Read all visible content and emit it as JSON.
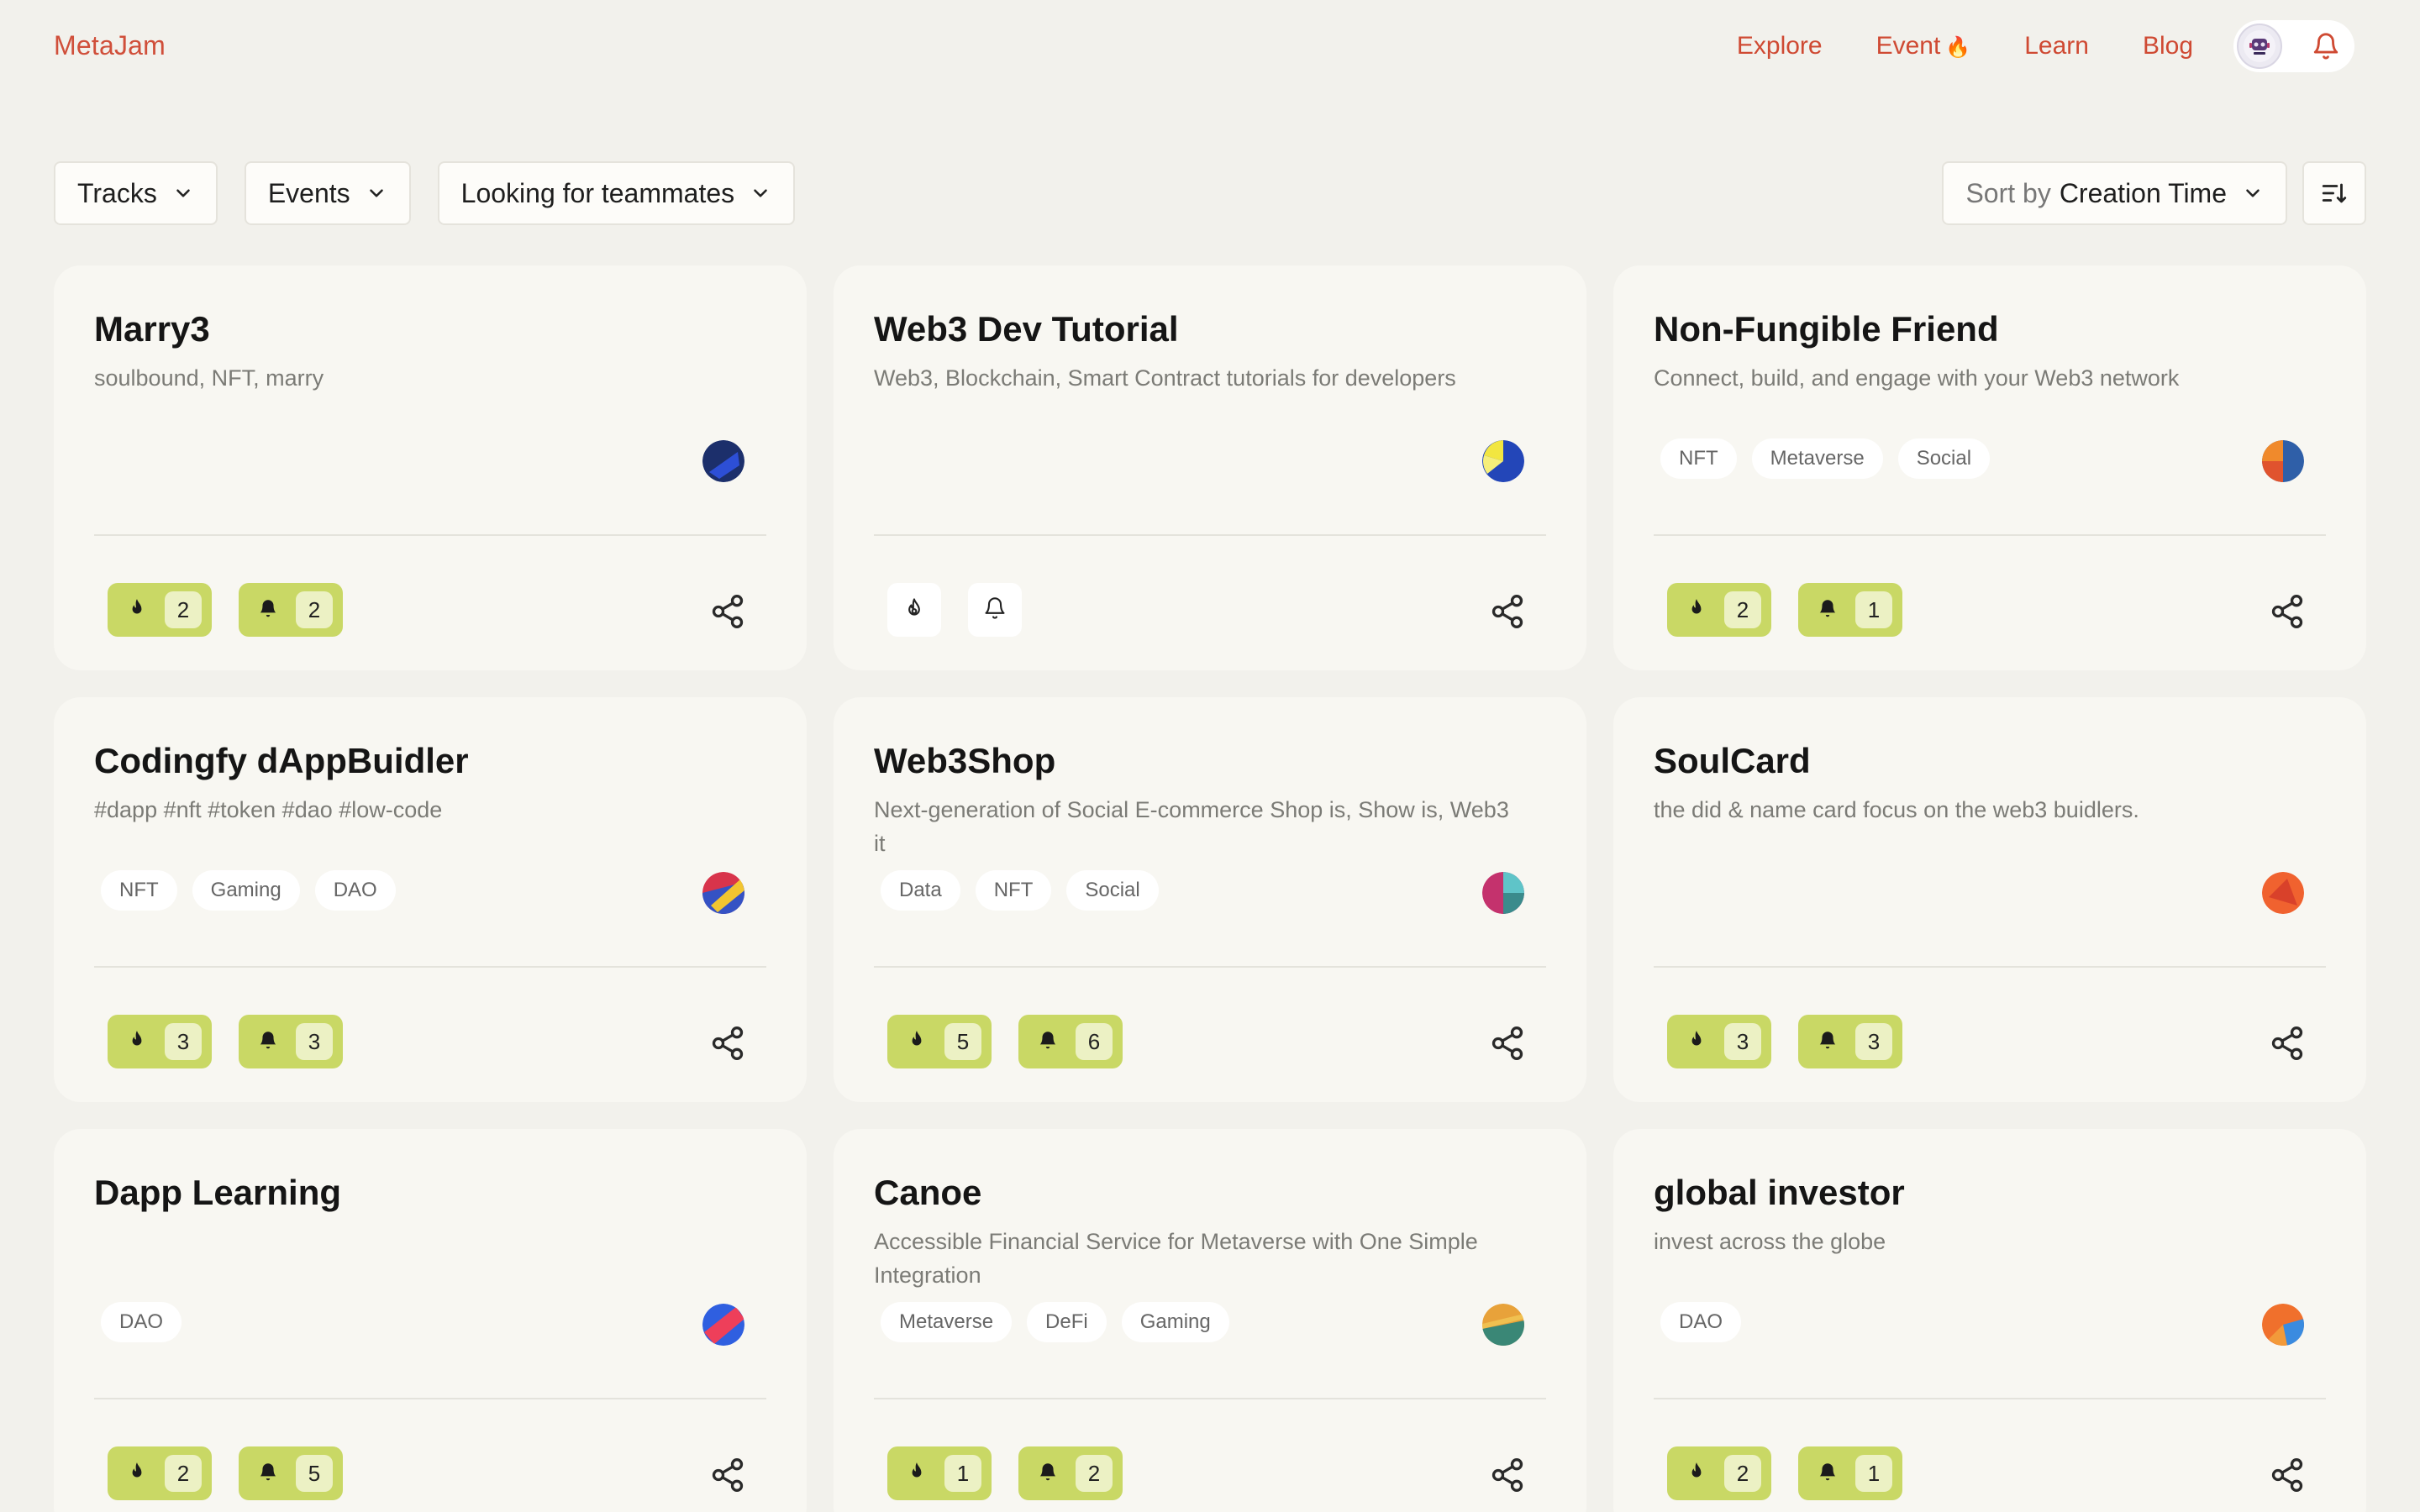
{
  "header": {
    "logo": "MetaJam",
    "nav": [
      {
        "label": "Explore"
      },
      {
        "label": "Event",
        "emoji": "🔥"
      },
      {
        "label": "Learn"
      },
      {
        "label": "Blog"
      }
    ]
  },
  "filters": {
    "tracks": "Tracks",
    "events": "Events",
    "looking": "Looking for teammates",
    "sort_prefix": "Sort by",
    "sort_value": "Creation Time"
  },
  "colors": {
    "accent": "#cf4a33",
    "stat_bg": "#c9d865",
    "card_bg": "#f8f7f2",
    "page_bg": "#f2f1ec"
  },
  "icons": {
    "fire": "fire-icon",
    "bell": "bell-icon",
    "share": "share-icon",
    "chevron": "chevron-down-icon",
    "sort": "sort-icon"
  },
  "projects": [
    {
      "title": "Marry3",
      "desc": "soulbound, NFT, marry",
      "tags": [],
      "likes": "2",
      "subs": "2"
    },
    {
      "title": "Web3 Dev Tutorial",
      "desc": "Web3, Blockchain, Smart Contract tutorials for developers",
      "tags": [],
      "likes": "",
      "subs": ""
    },
    {
      "title": "Non-Fungible Friend",
      "desc": "Connect, build, and engage with your Web3 network",
      "tags": [
        "NFT",
        "Metaverse",
        "Social"
      ],
      "likes": "2",
      "subs": "1"
    },
    {
      "title": "Codingfy dAppBuidler",
      "desc": "#dapp #nft #token #dao #low-code",
      "tags": [
        "NFT",
        "Gaming",
        "DAO"
      ],
      "likes": "3",
      "subs": "3"
    },
    {
      "title": "Web3Shop",
      "desc": "Next-generation of Social E-commerce Shop is, Show is, Web3 it",
      "tags": [
        "Data",
        "NFT",
        "Social"
      ],
      "likes": "5",
      "subs": "6"
    },
    {
      "title": "SoulCard",
      "desc": "the did & name card focus on the web3 buidlers.",
      "tags": [],
      "likes": "3",
      "subs": "3"
    },
    {
      "title": "Dapp Learning",
      "desc": "",
      "tags": [
        "DAO"
      ],
      "likes": "2",
      "subs": "5"
    },
    {
      "title": "Canoe",
      "desc": "Accessible Financial Service for Metaverse with One Simple Integration",
      "tags": [
        "Metaverse",
        "DeFi",
        "Gaming"
      ],
      "likes": "1",
      "subs": "2"
    },
    {
      "title": "global investor",
      "desc": "invest across the globe",
      "tags": [
        "DAO"
      ],
      "likes": "2",
      "subs": "1"
    }
  ]
}
